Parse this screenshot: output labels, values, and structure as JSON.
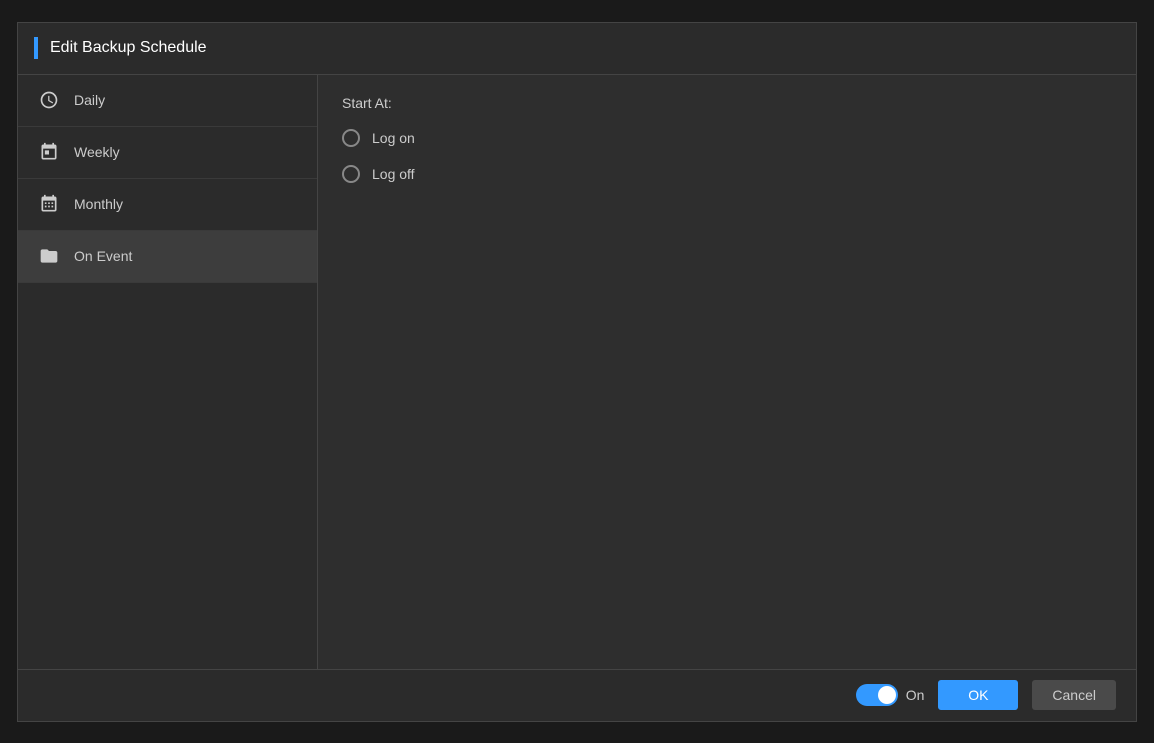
{
  "dialog": {
    "title": "Edit Backup Schedule",
    "accent_color": "#3399ff"
  },
  "sidebar": {
    "items": [
      {
        "id": "daily",
        "label": "Daily",
        "icon": "clock-icon",
        "active": false
      },
      {
        "id": "weekly",
        "label": "Weekly",
        "icon": "calendar-week-icon",
        "active": false
      },
      {
        "id": "monthly",
        "label": "Monthly",
        "icon": "calendar-month-icon",
        "active": false
      },
      {
        "id": "on-event",
        "label": "On Event",
        "icon": "folder-icon",
        "active": true
      }
    ]
  },
  "main": {
    "start_at_label": "Start At:",
    "radio_options": [
      {
        "id": "log-on",
        "label": "Log on",
        "selected": false
      },
      {
        "id": "log-off",
        "label": "Log off",
        "selected": false
      }
    ]
  },
  "footer": {
    "toggle_label": "On",
    "toggle_on": true,
    "ok_label": "OK",
    "cancel_label": "Cancel"
  }
}
